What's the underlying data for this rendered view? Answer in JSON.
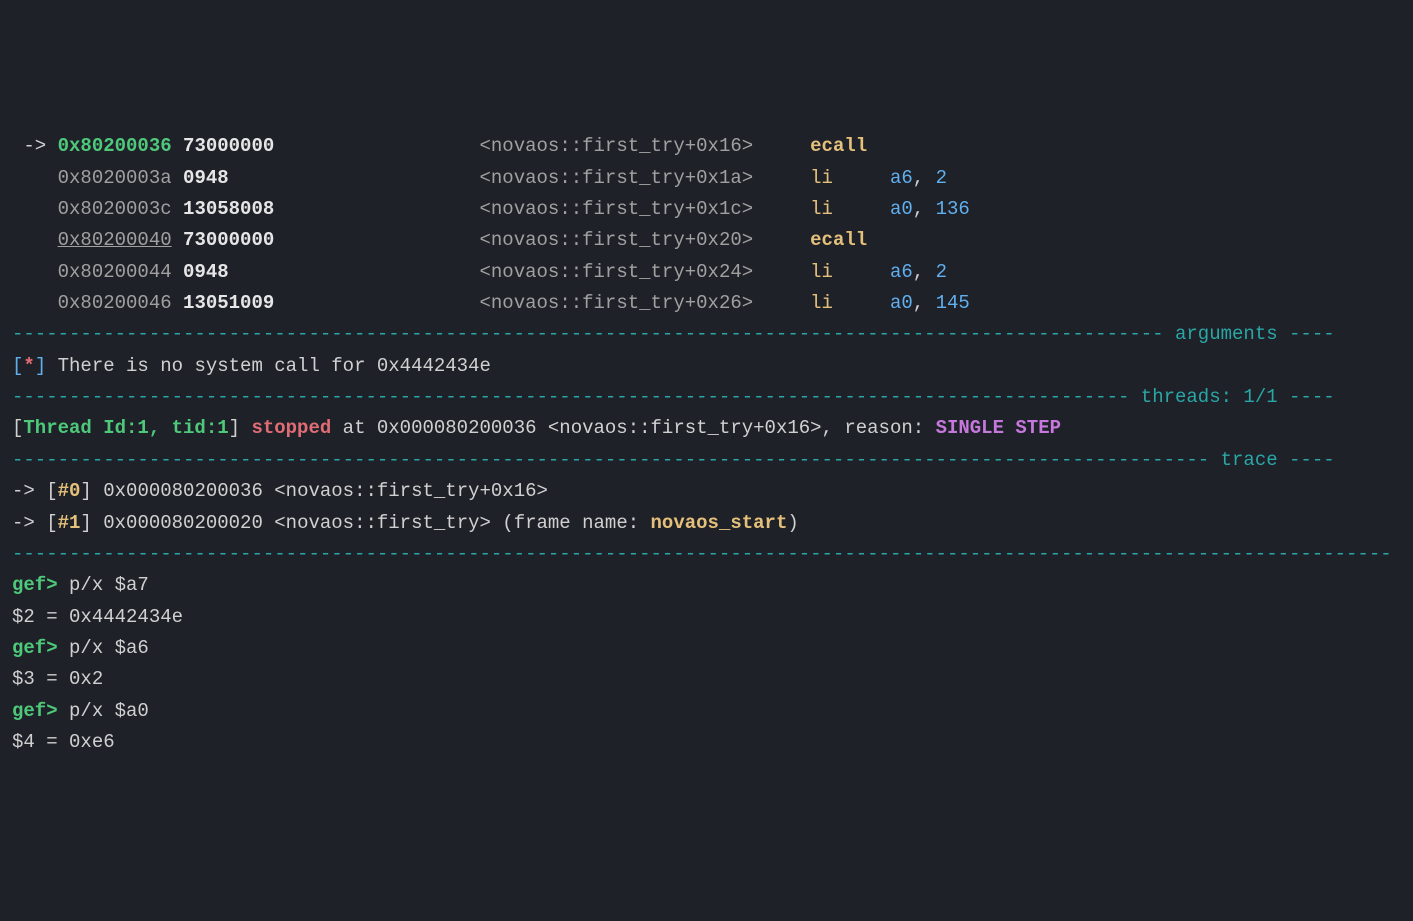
{
  "disasm": [
    {
      "arrow": " -> ",
      "addr": "0x80200036",
      "opcode": "73000000",
      "sym": "<novaos::first_try+0x16>",
      "mnem": "ecall",
      "reg": "",
      "val": "",
      "current": true
    },
    {
      "arrow": "    ",
      "addr": "0x8020003a",
      "opcode": "0948",
      "sym": "<novaos::first_try+0x1a>",
      "mnem": "li",
      "reg": "a6",
      "val": "2",
      "current": false
    },
    {
      "arrow": "    ",
      "addr": "0x8020003c",
      "opcode": "13058008",
      "sym": "<novaos::first_try+0x1c>",
      "mnem": "li",
      "reg": "a0",
      "val": "136",
      "current": false
    },
    {
      "arrow": "    ",
      "addr": "0x80200040",
      "opcode": "73000000",
      "sym": "<novaos::first_try+0x20>",
      "mnem": "ecall",
      "reg": "",
      "val": "",
      "current": false,
      "underline": true
    },
    {
      "arrow": "    ",
      "addr": "0x80200044",
      "opcode": "0948",
      "sym": "<novaos::first_try+0x24>",
      "mnem": "li",
      "reg": "a6",
      "val": "2",
      "current": false
    },
    {
      "arrow": "    ",
      "addr": "0x80200046",
      "opcode": "13051009",
      "sym": "<novaos::first_try+0x26>",
      "mnem": "li",
      "reg": "a0",
      "val": "145",
      "current": false
    }
  ],
  "sections": {
    "arguments_label": "arguments",
    "threads_label": "threads: 1/1",
    "trace_label": "trace"
  },
  "syscall_msg": {
    "prefix": "[",
    "star": "*",
    "suffix": "]",
    "text": " There is no system call for 0x4442434e"
  },
  "thread_line": {
    "open": "[",
    "id": "Thread Id:1, tid:1",
    "close": "]",
    "stopped": " stopped",
    "at": " at 0x000080200036 <novaos::first_try+0x16>, reason: ",
    "reason": "SINGLE STEP"
  },
  "trace": [
    {
      "arrow": "-> [",
      "num": "#0",
      "close": "] ",
      "addr": "0x000080200036 <novaos::first_try+0x16>",
      "extra_pre": "",
      "frame_name": "",
      "extra_post": ""
    },
    {
      "arrow": "-> [",
      "num": "#1",
      "close": "] ",
      "addr": "0x000080200020 <novaos::first_try> (frame name: ",
      "extra_pre": "",
      "frame_name": "novaos_start",
      "extra_post": ")"
    }
  ],
  "cmds": [
    {
      "prompt": "gef>",
      "cmd": " p/x $a7",
      "out": "$2 = 0x4442434e"
    },
    {
      "prompt": "gef>",
      "cmd": " p/x $a6",
      "out": "$3 = 0x2"
    },
    {
      "prompt": "gef>",
      "cmd": " p/x $a0",
      "out": "$4 = 0xe6"
    }
  ],
  "dashes": {
    "full": "-------------------------------------------------------------------------------------------------------------------------",
    "args_pre": "----------------------------------------------------------------------------------------------------- ",
    "args_post": " ----",
    "threads_pre": "-------------------------------------------------------------------------------------------------- ",
    "threads_post": " ----",
    "trace_pre": "--------------------------------------------------------------------------------------------------------- ",
    "trace_post": " ----"
  }
}
